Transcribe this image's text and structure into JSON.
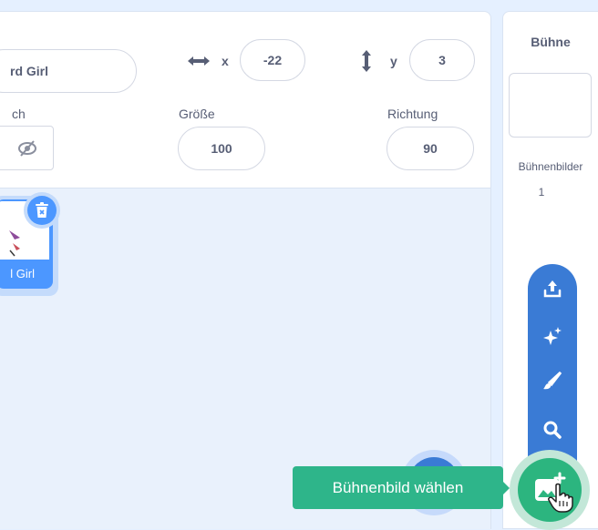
{
  "sprite": {
    "name_value": "rd Girl",
    "x_label": "x",
    "x_value": "-22",
    "y_label": "y",
    "y_value": "3",
    "show_label": "ch",
    "size_label": "Größe",
    "size_value": "100",
    "direction_label": "Richtung",
    "direction_value": "90"
  },
  "sprite_list": {
    "thumb_label": "l Girl"
  },
  "stage": {
    "title": "Bühne",
    "backdrops_label": "Bühnenbilder",
    "backdrops_count": "1"
  },
  "backdrop_menu": {
    "tooltip": "Bühnenbild wählen",
    "items": [
      "upload-icon",
      "surprise-icon",
      "paint-icon",
      "search-icon"
    ],
    "main_button": "choose-backdrop-icon"
  },
  "colors": {
    "accent_blue": "#4c97ff",
    "menu_blue": "#3a7bd5",
    "green": "#2cb57f",
    "tooltip_green": "#2eb58a"
  }
}
